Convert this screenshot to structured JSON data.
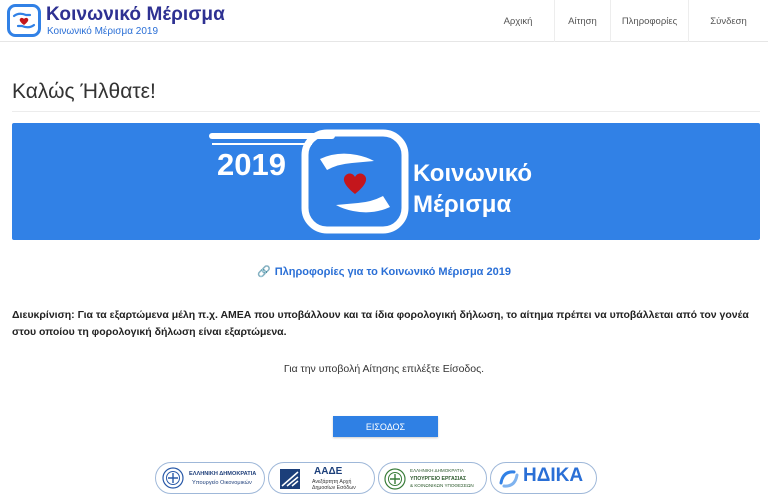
{
  "brand": {
    "title": "Κοινωνικό Μέρισμα",
    "subtitle": "Κοινωνικό Μέρισμα 2019"
  },
  "nav": [
    {
      "label": "Αρχική"
    },
    {
      "label": "Αίτηση"
    },
    {
      "label": "Πληροφορίες"
    },
    {
      "label": "Σύνδεση"
    }
  ],
  "welcome": "Καλώς Ήλθατε!",
  "banner": {
    "year": "2019",
    "line1": "Κοινωνικό",
    "line2": "Μέρισμα",
    "background_color": "#3181e6"
  },
  "info_link": {
    "icon": "link-icon",
    "label": "Πληροφορίες για το Κοινωνικό Μέρισμα 2019"
  },
  "clarification": "Διευκρίνιση: Για τα εξαρτώμενα μέλη π.χ. ΑΜΕΑ που υποβάλλουν και τα ίδια φορολογική δήλωση, το αίτημα πρέπει να υποβάλλεται από τον γονέα στου οποίου τη φορολογική δήλωση είναι εξαρτώμενα.",
  "instruction": "Για την υποβολή Αίτησης επιλέξτε Είσοδος.",
  "login_button": "ΕΙΣΟΔΟΣ",
  "partners": [
    {
      "name": "ministry-finance",
      "line1": "ΕΛΛΗΝΙΚΗ ΔΗΜΟΚΡΑΤΙΑ",
      "line2": "Υπουργείο Οικονομικών"
    },
    {
      "name": "aade",
      "line1": "ΑΑΔΕ",
      "line2": "Ανεξάρτητη Αρχή",
      "line3": "Δημοσίων Εσόδων"
    },
    {
      "name": "ministry-labour",
      "line1": "ΕΛΛΗΝΙΚΗ ΔΗΜΟΚΡΑΤΙΑ",
      "line2": "ΥΠΟΥΡΓΕΙΟ ΕΡΓΑΣΙΑΣ",
      "line3": "& ΚΟΙΝΩΝΙΚΩΝ ΥΠΟΘΕΣΕΩΝ"
    },
    {
      "name": "idika",
      "line1": "ΗΔΙΚΑ"
    }
  ],
  "colors": {
    "brand_dark": "#2e3192",
    "link_blue": "#2a6fd6",
    "button_blue": "#2f80e4",
    "heart_red": "#c4161c"
  }
}
